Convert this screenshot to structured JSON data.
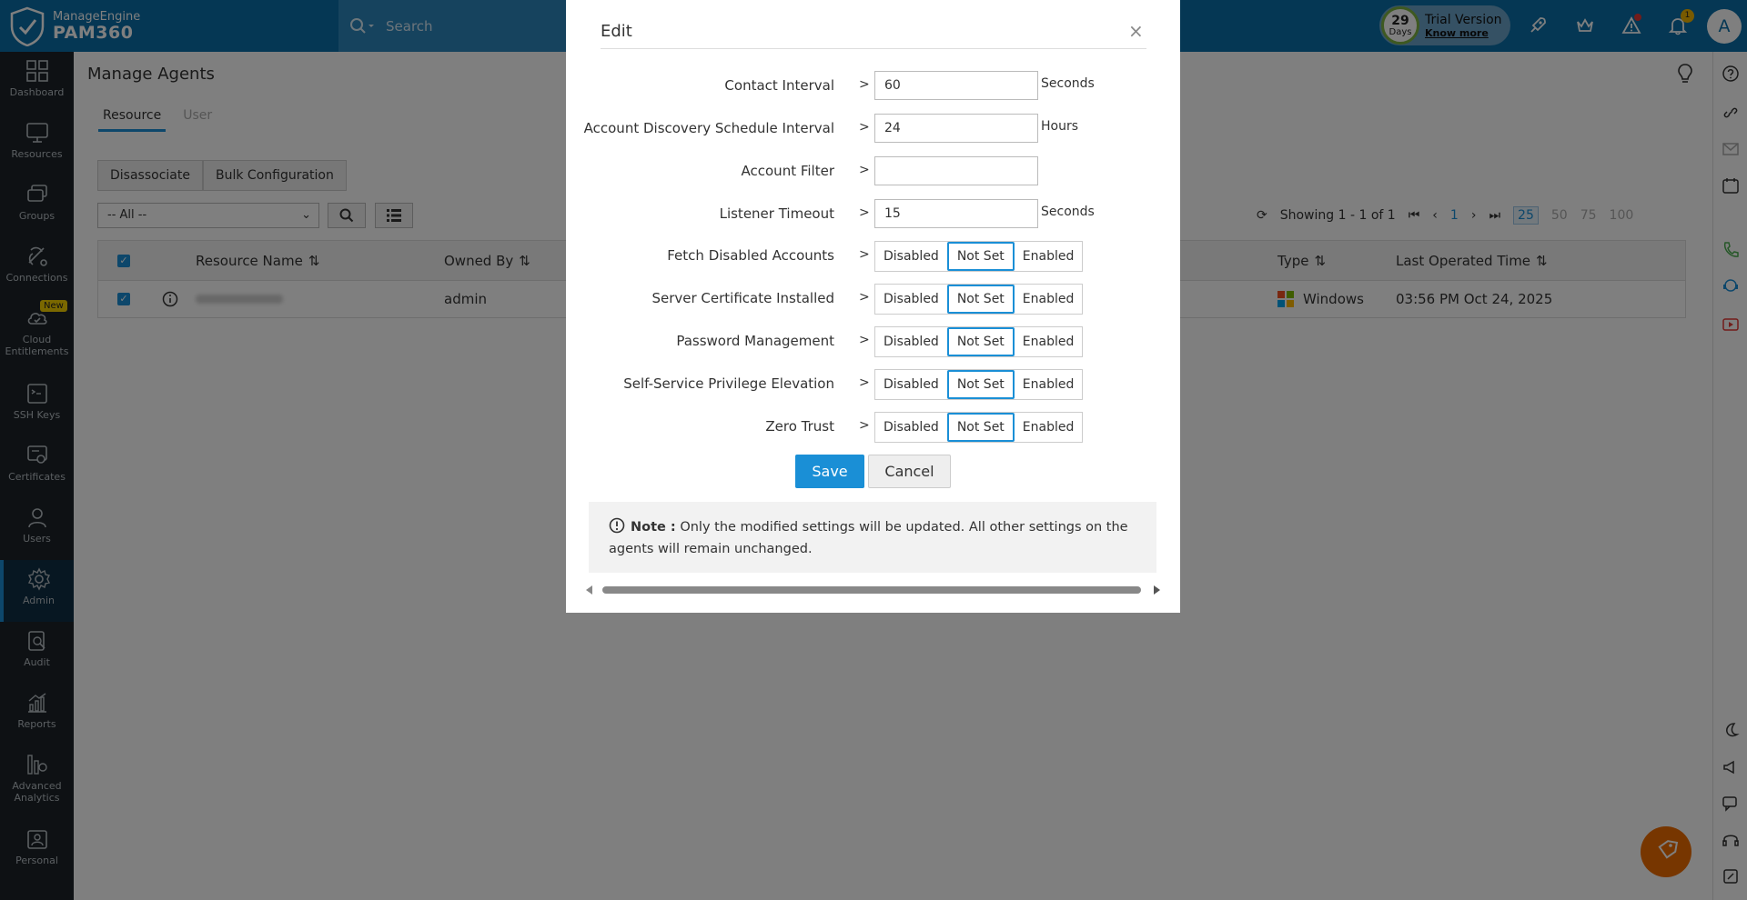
{
  "header": {
    "brand_small": "ManageEngine",
    "brand_big": "PAM360",
    "search_placeholder": "Search",
    "trial_days": "29",
    "trial_days_label": "Days",
    "trial_title": "Trial Version",
    "trial_link": "Know more",
    "notification_count": "1",
    "avatar_letter": "A"
  },
  "nav": [
    {
      "label": "Dashboard",
      "icon": "dashboard-icon"
    },
    {
      "label": "Resources",
      "icon": "monitor-icon"
    },
    {
      "label": "Groups",
      "icon": "groups-icon"
    },
    {
      "label": "Connections",
      "icon": "connections-icon"
    },
    {
      "label": "Cloud Entitlements",
      "icon": "cloud-icon",
      "badge": "New"
    },
    {
      "label": "SSH Keys",
      "icon": "ssh-key-icon"
    },
    {
      "label": "Certificates",
      "icon": "certificate-icon"
    },
    {
      "label": "Users",
      "icon": "user-icon"
    },
    {
      "label": "Admin",
      "icon": "gear-icon",
      "active": true
    },
    {
      "label": "Audit",
      "icon": "audit-icon"
    },
    {
      "label": "Reports",
      "icon": "reports-icon"
    },
    {
      "label": "Advanced Analytics",
      "icon": "analytics-icon"
    },
    {
      "label": "Personal",
      "icon": "personal-icon"
    }
  ],
  "page": {
    "title": "Manage Agents",
    "tabs": [
      "Resource",
      "User"
    ],
    "disassociate": "Disassociate",
    "bulk_config": "Bulk Configuration",
    "filter_value": "-- All --",
    "pager_text": "Showing 1 - 1 of 1",
    "pager_page": "1",
    "page_sizes": [
      "25",
      "50",
      "75",
      "100"
    ],
    "columns": [
      "Resource Name",
      "Owned By",
      "Type",
      "Last Operated Time"
    ],
    "row": {
      "owned_by": "admin",
      "type": "Windows",
      "last_time": "03:56 PM Oct 24, 2025"
    }
  },
  "modal": {
    "title": "Edit",
    "close": "×",
    "sep": ">",
    "fields": [
      {
        "label": "Contact Interval",
        "value": "60",
        "unit": "Seconds"
      },
      {
        "label": "Account Discovery Schedule Interval",
        "value": "24",
        "unit": "Hours"
      },
      {
        "label": "Account Filter",
        "value": "",
        "unit": ""
      },
      {
        "label": "Listener Timeout",
        "value": "15",
        "unit": "Seconds"
      }
    ],
    "toggles": [
      {
        "label": "Fetch Disabled Accounts"
      },
      {
        "label": "Server Certificate Installed"
      },
      {
        "label": "Password Management"
      },
      {
        "label": "Self-Service Privilege Elevation"
      },
      {
        "label": "Zero Trust"
      }
    ],
    "options": [
      "Disabled",
      "Not Set",
      "Enabled"
    ],
    "selected_option": "Not Set",
    "save": "Save",
    "cancel": "Cancel",
    "note_label": "Note :",
    "note_text": "Only the modified settings will be updated. All other settings on the agents will remain unchanged."
  }
}
